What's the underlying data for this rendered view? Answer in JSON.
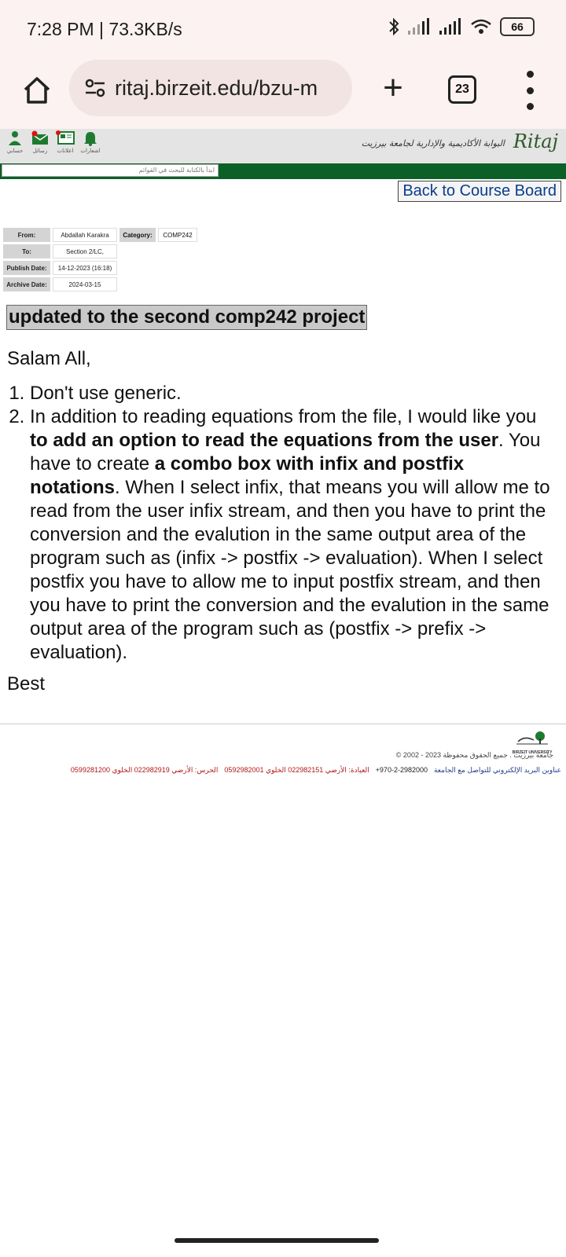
{
  "status_bar": {
    "time": "7:28 PM | 73.3KB/s",
    "battery": "66"
  },
  "browser": {
    "url": "ritaj.birzeit.edu/bzu-m",
    "tab_count": "23"
  },
  "site": {
    "title": "البوابة الأكاديمية والإدارية لجامعة بيرزيت",
    "logo": "Ritaj",
    "nav_icons": [
      {
        "label": "حسابي",
        "icon": "user-icon"
      },
      {
        "label": "رسائل",
        "icon": "mail-icon"
      },
      {
        "label": "اعلانات",
        "icon": "news-icon"
      },
      {
        "label": "اشعارات",
        "icon": "bell-icon"
      }
    ],
    "search_placeholder": "ابدأ بالكتابة للبحث في القوائم",
    "back_button": "Back to Course Board"
  },
  "message": {
    "from_label": "From:",
    "from": "Abdallah Karakra",
    "category_label": "Category:",
    "category": "COMP242",
    "to_label": "To:",
    "to": "Section 2/LC,",
    "publish_label": "Publish Date:",
    "publish_date": "14-12-2023 (16:18)",
    "archive_label": "Archive Date:",
    "archive_date": "2024-03-15",
    "subject": "updated to the second comp242 project",
    "greeting": "Salam All,",
    "item1": "Don't use generic.",
    "item2_a": "In addition to reading equations from the file, I would like you ",
    "item2_b": "to add an option to read the equations from the user",
    "item2_c": ". You have to create ",
    "item2_d": "a combo box with infix and postfix notations",
    "item2_e": ". When I select infix, that means you will allow me to read from the user infix stream, and then you have to print the conversion and the evalution in the same output area of the program  such as (infix -> postfix -> evaluation). When I select postfix you have to allow me to input postfix stream, and then you have to print the conversion and the evalution in the same output area of the program such as (postfix -> prefix -> evaluation).",
    "closing": "Best"
  },
  "footer": {
    "university": "BIRZEIT UNIVERSITY",
    "copyright": "© 2002 - 2023 جامعة بيرزيت . جميع الحقوق محفوظة",
    "email_link": "عناوين البريد الإلكتروني للتواصل مع الجامعة",
    "phone": "+970-2-2982000",
    "clinic": "العيادة: الأرضي 022982151  الخلوي 0592982001",
    "guard": "الحرس: الأرضي 022982919  الخلوي 0599281200"
  }
}
